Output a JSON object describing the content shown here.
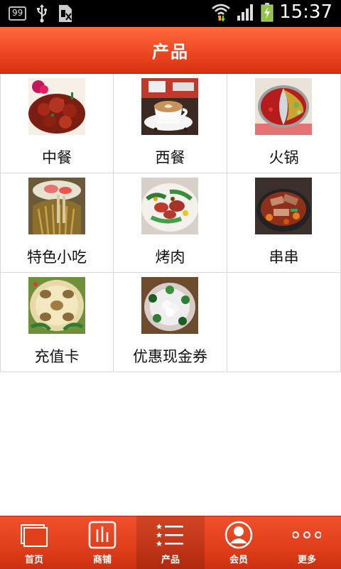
{
  "status_bar": {
    "badge": "99",
    "time": "15:37"
  },
  "header": {
    "title": "产品"
  },
  "products": [
    {
      "label": "中餐"
    },
    {
      "label": "西餐"
    },
    {
      "label": "火锅"
    },
    {
      "label": "特色小吃"
    },
    {
      "label": "烤肉"
    },
    {
      "label": "串串"
    },
    {
      "label": "充值卡"
    },
    {
      "label": "优惠现金券"
    }
  ],
  "tabs": [
    {
      "label": "首页",
      "icon": "home-icon"
    },
    {
      "label": "商铺",
      "icon": "shop-icon"
    },
    {
      "label": "产品",
      "icon": "products-icon",
      "active": true
    },
    {
      "label": "会员",
      "icon": "member-icon"
    },
    {
      "label": "更多",
      "icon": "more-icon"
    }
  ],
  "colors": {
    "accent": "#e8431f",
    "status_bar": "#000000"
  }
}
